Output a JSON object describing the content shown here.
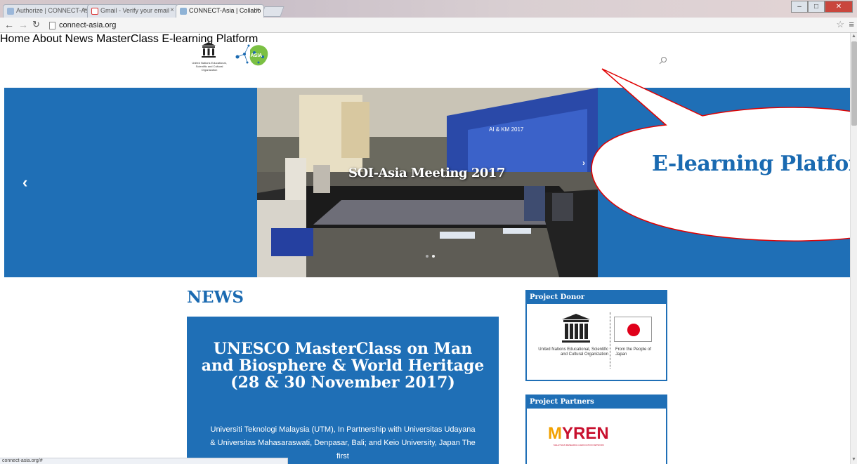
{
  "browser": {
    "tabs": [
      {
        "label": "Authorize | CONNECT-As",
        "active": false
      },
      {
        "label": "Gmail - Verify your email",
        "active": false
      },
      {
        "label": "CONNECT-Asia | Collabo",
        "active": true
      }
    ],
    "url": "connect-asia.org",
    "status_url": "connect-asia.org/#"
  },
  "header": {
    "unesco_caption": "United Nations Educational, Scientific and Cultural Organization",
    "connect_logo_text": "ASIA",
    "nav": [
      "Home",
      "About",
      "News",
      "MasterClass",
      "E-learning Platform"
    ]
  },
  "hero": {
    "caption": "SOI-Asia Meeting 2017",
    "banner_text": "AI & KM 2017"
  },
  "callout": {
    "text": "E-learning Platform"
  },
  "news": {
    "heading": "NEWS",
    "card_title": "UNESCO MasterClass on Man and Biosphere & World Heritage (28 & 30 November 2017)",
    "card_body": "Universiti Teknologi Malaysia (UTM), In Partnership with Universitas Udayana & Universitas Mahasaraswati, Denpasar, Bali; and Keio University, Japan The first"
  },
  "sidebar": {
    "donor_title": "Project Donor",
    "donor_unesco_text": "United Nations Educational, Scientific and Cultural Organization",
    "donor_japan_text": "From the People of Japan",
    "partners_title": "Project Partners",
    "partner_logo": "MYREN",
    "partner_logo_first": "M",
    "partner_logo_rest": "YREN",
    "partner_sub": "MALAYSIAN RESEARCH & EDUCATION NETWORK"
  },
  "colors": {
    "brand_blue": "#1f6fb6",
    "link_blue": "#1a6ab1",
    "callout_red": "#e00000"
  }
}
